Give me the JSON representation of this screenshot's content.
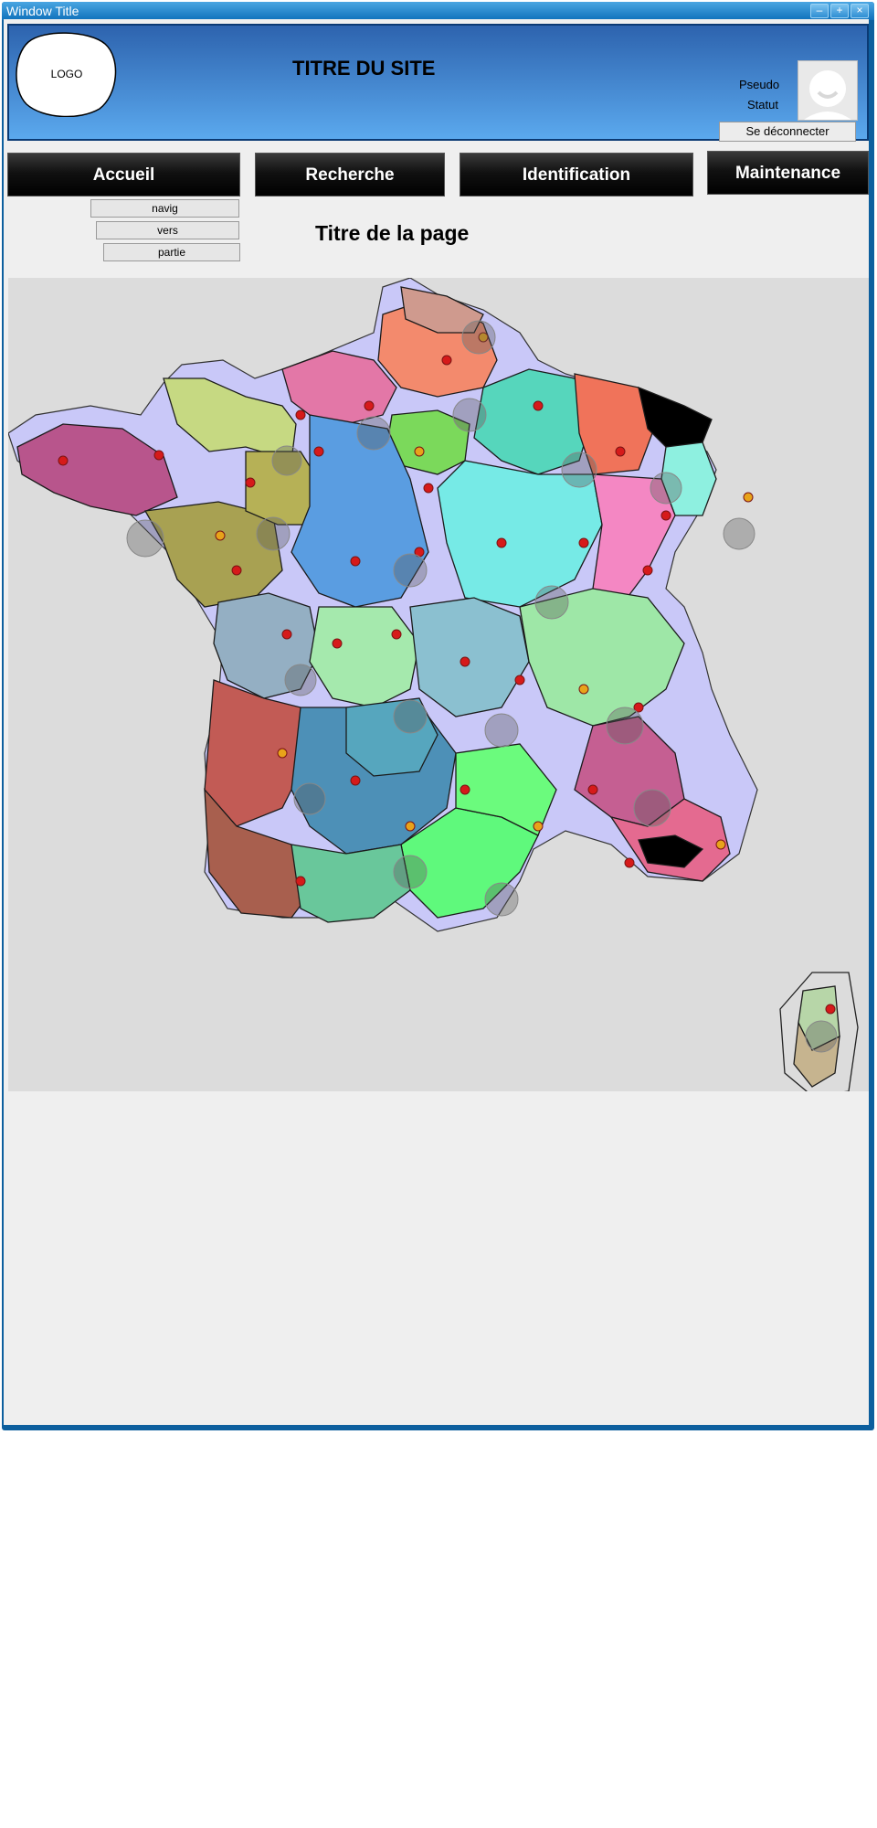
{
  "window": {
    "title": "Window Title",
    "controls": [
      "minimize-icon",
      "maximize-icon",
      "close-icon"
    ]
  },
  "header": {
    "logo_text": "LOGO",
    "site_title": "TITRE DU SITE",
    "user": {
      "pseudo": "Pseudo",
      "statut": "Statut",
      "logout_label": "Se déconnecter"
    }
  },
  "nav": {
    "items": [
      {
        "label": "Accueil"
      },
      {
        "label": "Recherche"
      },
      {
        "label": "Identification"
      },
      {
        "label": "Maintenance"
      }
    ],
    "breadcrumb": [
      "navig",
      "vers",
      "partie"
    ]
  },
  "page": {
    "title": "Titre de la page"
  },
  "map": {
    "description_icon": "map-of-france-regions"
  },
  "colors": {
    "window_border": "#0d5f9e",
    "header_top": "#2d63ae",
    "header_bottom": "#5ba9ee"
  }
}
